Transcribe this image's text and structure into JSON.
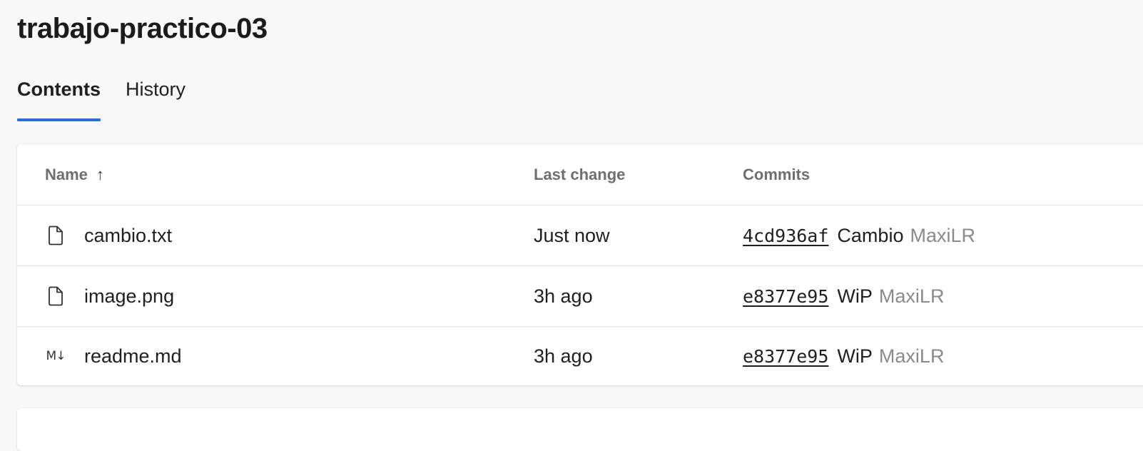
{
  "page": {
    "title": "trabajo-practico-03"
  },
  "tabs": [
    {
      "label": "Contents",
      "active": true
    },
    {
      "label": "History",
      "active": false
    }
  ],
  "table": {
    "columns": {
      "name": "Name",
      "name_sort": "↑",
      "last_change": "Last change",
      "commits": "Commits"
    },
    "rows": [
      {
        "icon": "file-icon",
        "name": "cambio.txt",
        "last_change": "Just now",
        "commit_hash": "4cd936af",
        "commit_message": "Cambio",
        "commit_author": "MaxiLR"
      },
      {
        "icon": "file-icon",
        "name": "image.png",
        "last_change": "3h ago",
        "commit_hash": "e8377e95",
        "commit_message": "WiP",
        "commit_author": "MaxiLR"
      },
      {
        "icon": "markdown-icon",
        "icon_text": "M↓",
        "name": "readme.md",
        "last_change": "3h ago",
        "commit_hash": "e8377e95",
        "commit_message": "WiP",
        "commit_author": "MaxiLR"
      }
    ]
  },
  "colors": {
    "accent": "#2b6fd6",
    "background": "#f8f8f8",
    "muted_text": "#8a8a8a"
  }
}
